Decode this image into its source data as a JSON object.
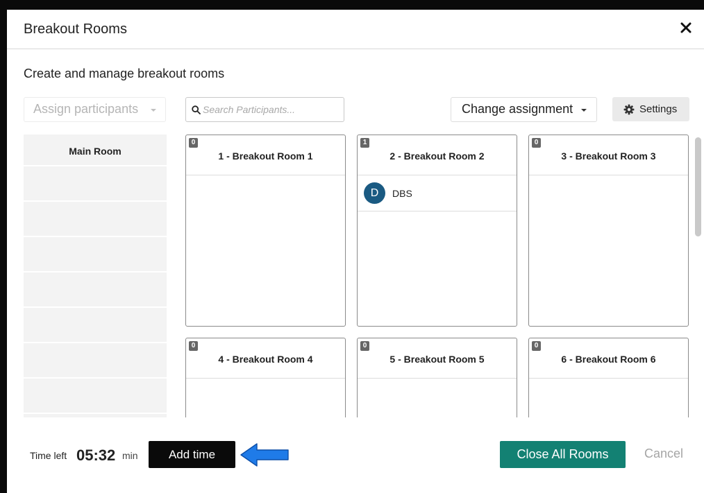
{
  "dialog": {
    "title": "Breakout Rooms",
    "subtitle": "Create and manage breakout rooms"
  },
  "toolbar": {
    "assign_label": "Assign participants",
    "search_placeholder": "Search Participants...",
    "change_label": "Change assignment",
    "settings_label": "Settings"
  },
  "main_room": {
    "title": "Main Room"
  },
  "rooms": [
    {
      "title": "1 - Breakout Room 1",
      "count": "0",
      "participants": []
    },
    {
      "title": "2 - Breakout Room 2",
      "count": "1",
      "participants": [
        {
          "initial": "D",
          "name": "DBS"
        }
      ]
    },
    {
      "title": "3 - Breakout Room 3",
      "count": "0",
      "participants": []
    },
    {
      "title": "4 - Breakout Room 4",
      "count": "0",
      "participants": []
    },
    {
      "title": "5 - Breakout Room 5",
      "count": "0",
      "participants": []
    },
    {
      "title": "6 - Breakout Room 6",
      "count": "0",
      "participants": []
    }
  ],
  "footer": {
    "time_left_label": "Time left",
    "time_left_value": "05:32",
    "time_unit": "min",
    "add_time_label": "Add time",
    "close_all_label": "Close All Rooms",
    "cancel_label": "Cancel"
  },
  "colors": {
    "accent_teal": "#138173",
    "avatar_blue": "#1a5a82",
    "annotation_arrow": "#1f7be8"
  }
}
